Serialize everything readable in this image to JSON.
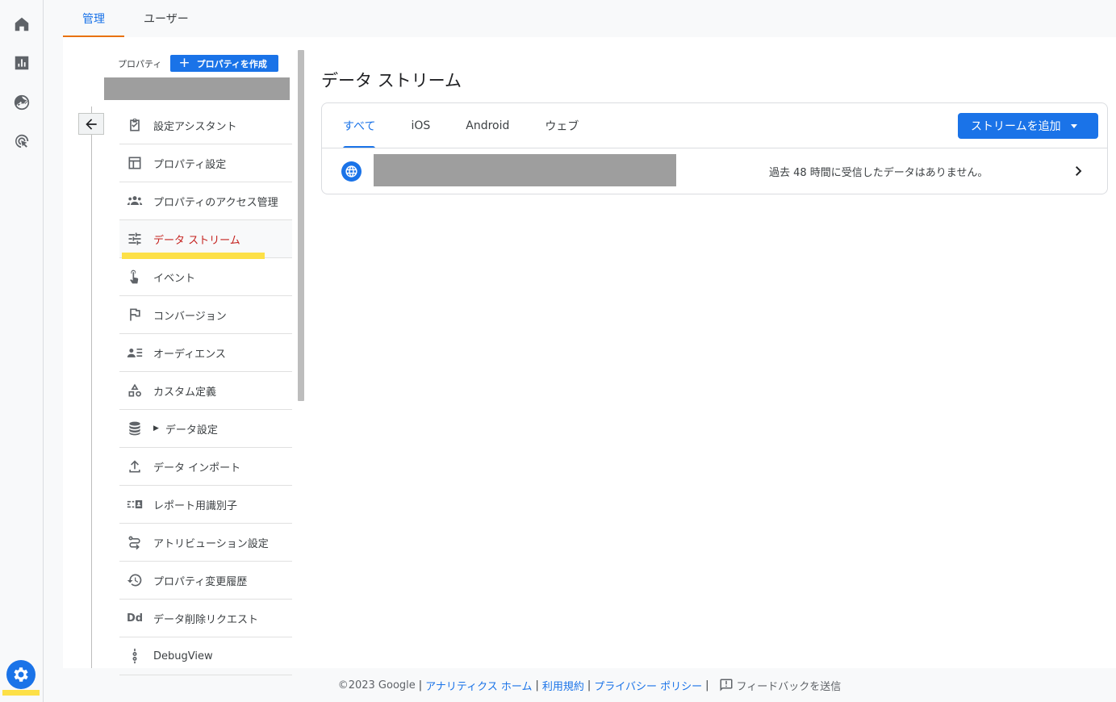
{
  "rail": {
    "items": [
      {
        "name": "home-icon"
      },
      {
        "name": "reports-icon"
      },
      {
        "name": "explore-icon"
      },
      {
        "name": "advertising-icon"
      }
    ],
    "admin": {
      "name": "admin-gear-icon"
    }
  },
  "top_tabs": [
    {
      "label": "管理",
      "active": true
    },
    {
      "label": "ユーザー",
      "active": false
    }
  ],
  "property": {
    "label": "プロパティ",
    "create_button": "プロパティを作成",
    "create_icon": "plus-icon"
  },
  "menu": [
    {
      "label": "設定アシスタント",
      "icon": "checklist-icon"
    },
    {
      "label": "プロパティ設定",
      "icon": "layout-icon"
    },
    {
      "label": "プロパティのアクセス管理",
      "icon": "people-icon"
    },
    {
      "label": "データ ストリーム",
      "icon": "streams-icon",
      "active": true
    },
    {
      "label": "イベント",
      "icon": "touch-icon"
    },
    {
      "label": "コンバージョン",
      "icon": "flag-icon"
    },
    {
      "label": "オーディエンス",
      "icon": "audience-icon"
    },
    {
      "label": "カスタム定義",
      "icon": "shapes-icon"
    },
    {
      "label": "データ設定",
      "icon": "database-icon",
      "expandable": true
    },
    {
      "label": "データ インポート",
      "icon": "upload-icon"
    },
    {
      "label": "レポート用識別子",
      "icon": "identity-icon"
    },
    {
      "label": "アトリビューション設定",
      "icon": "route-icon"
    },
    {
      "label": "プロパティ変更履歴",
      "icon": "history-icon"
    },
    {
      "label": "データ削除リクエスト",
      "icon": "dd-icon",
      "icon_text": "Dd"
    },
    {
      "label": "DebugView",
      "icon": "debug-icon"
    }
  ],
  "content": {
    "title": "データ ストリーム",
    "tabs": [
      {
        "label": "すべて",
        "active": true
      },
      {
        "label": "iOS",
        "active": false
      },
      {
        "label": "Android",
        "active": false
      },
      {
        "label": "ウェブ",
        "active": false
      }
    ],
    "add_button": "ストリームを追加",
    "stream": {
      "icon": "globe-icon",
      "status": "過去 48 時間に受信したデータはありません。"
    }
  },
  "footer": {
    "copyright": "©2023 Google",
    "links": [
      "アナリティクス ホーム",
      "利用規約",
      "プライバシー ポリシー"
    ],
    "feedback": "フィードバックを送信"
  },
  "colors": {
    "accent": "#1a73e8",
    "active_menu_text": "#c5221f",
    "tab_underline": "#e8710a",
    "highlight": "#fde047"
  }
}
